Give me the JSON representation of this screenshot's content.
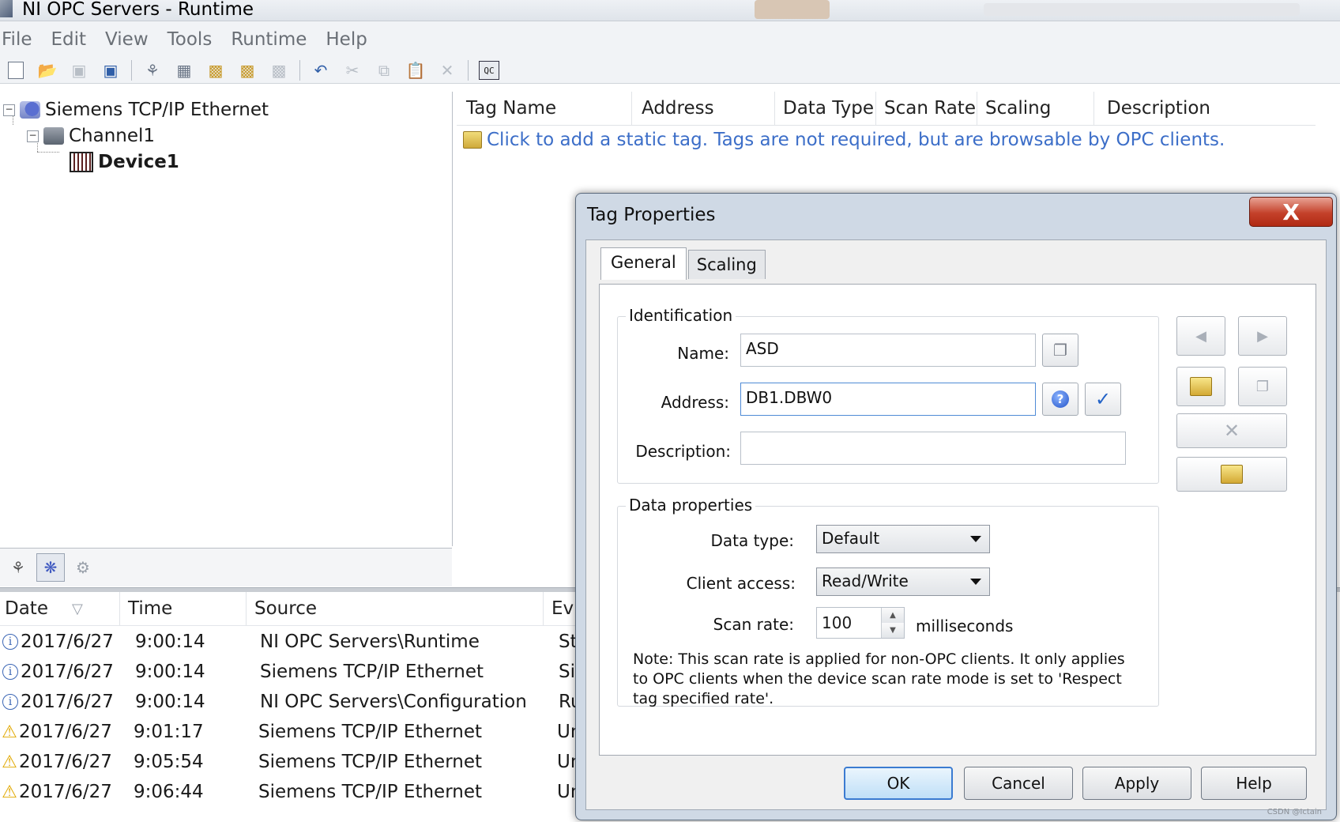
{
  "window": {
    "title": "NI OPC Servers - Runtime"
  },
  "menu": [
    "File",
    "Edit",
    "View",
    "Tools",
    "Runtime",
    "Help"
  ],
  "toolbar": [
    {
      "icon": "new-file-icon"
    },
    {
      "icon": "open-folder-icon"
    },
    {
      "icon": "save-icon"
    },
    {
      "icon": "save-as-icon"
    },
    {
      "icon": "new-channel-icon"
    },
    {
      "icon": "new-device-icon"
    },
    {
      "icon": "new-tag-group-icon"
    },
    {
      "icon": "new-tag-icon"
    },
    {
      "icon": "bulk-tag-icon"
    },
    {
      "icon": "undo-icon"
    },
    {
      "icon": "cut-icon"
    },
    {
      "icon": "copy-icon"
    },
    {
      "icon": "paste-icon"
    },
    {
      "icon": "delete-icon"
    },
    {
      "icon": "quick-client-icon",
      "label": "QC"
    }
  ],
  "tree": {
    "root": "Siemens TCP/IP Ethernet",
    "channel": "Channel1",
    "device": "Device1"
  },
  "tag_list": {
    "columns": [
      "Tag Name",
      "Address",
      "Data Type",
      "Scan Rate",
      "Scaling",
      "Description"
    ],
    "add_hint": "Click to add a static tag.  Tags are not required, but are browsable by OPC clients."
  },
  "event_log": {
    "columns": [
      "Date",
      "Time",
      "Source",
      "Ev"
    ],
    "rows": [
      {
        "level": "info",
        "date": "2017/6/27",
        "time": "9:00:14",
        "source": "NI OPC Servers\\Runtime",
        "event": "Sta"
      },
      {
        "level": "info",
        "date": "2017/6/27",
        "time": "9:00:14",
        "source": "Siemens TCP/IP Ethernet",
        "event": "Sie"
      },
      {
        "level": "info",
        "date": "2017/6/27",
        "time": "9:00:14",
        "source": "NI OPC Servers\\Configuration",
        "event": "Ru"
      },
      {
        "level": "warning",
        "date": "2017/6/27",
        "time": "9:01:17",
        "source": "Siemens TCP/IP Ethernet",
        "event": "Un"
      },
      {
        "level": "warning",
        "date": "2017/6/27",
        "time": "9:05:54",
        "source": "Siemens TCP/IP Ethernet",
        "event": "Un"
      },
      {
        "level": "warning",
        "date": "2017/6/27",
        "time": "9:06:44",
        "source": "Siemens TCP/IP Ethernet",
        "event": "Un"
      }
    ]
  },
  "dialog": {
    "title": "Tag Properties",
    "close_label": "X",
    "tabs": [
      "General",
      "Scaling"
    ],
    "identification": {
      "legend": "Identification",
      "name_label": "Name:",
      "name_value": "ASD",
      "address_label": "Address:",
      "address_value": "DB1.DBW0",
      "description_label": "Description:",
      "description_value": ""
    },
    "data_properties": {
      "legend": "Data properties",
      "data_type_label": "Data type:",
      "data_type_value": "Default",
      "client_access_label": "Client access:",
      "client_access_value": "Read/Write",
      "scan_rate_label": "Scan rate:",
      "scan_rate_value": "100",
      "scan_rate_unit": "milliseconds",
      "note": "Note: This scan rate is applied for non-OPC clients. It only applies to OPC clients when the device scan rate mode is set to 'Respect tag specified rate'."
    },
    "buttons": {
      "ok": "OK",
      "cancel": "Cancel",
      "apply": "Apply",
      "help": "Help"
    }
  },
  "watermark": "CSDN @Ictain"
}
